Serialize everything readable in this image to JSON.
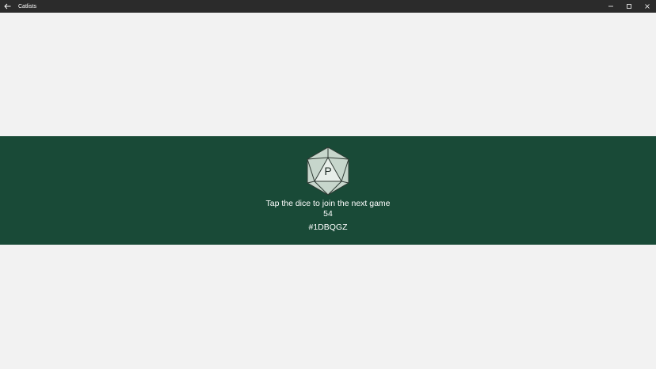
{
  "window": {
    "title": "Catlists"
  },
  "icons": {
    "back": "back-arrow-icon",
    "minimize": "minimize-icon",
    "maximize": "maximize-icon",
    "close": "close-icon",
    "dice": "d20-dice-icon"
  },
  "banner": {
    "background_color": "#194a37",
    "dice_letter": "P",
    "prompt": "Tap the dice to join the next game",
    "count": "54",
    "game_code": "#1DBQGZ"
  }
}
